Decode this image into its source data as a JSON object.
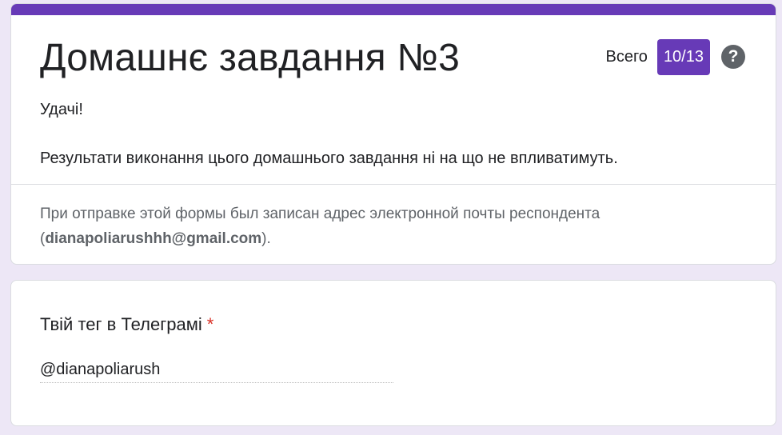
{
  "header": {
    "title": "Домашнє завдання №3",
    "score_label": "Всего",
    "score_value": "10/13",
    "help_icon": "?",
    "description_line1": "Удачі!",
    "description_line2": "Результати виконання цього домашнього завдання ні на що не впливатимуть.",
    "email_note_prefix": "При отправке этой формы был записан адрес электронной почты респондента (",
    "email_address": "dianapoliarushhh@gmail.com",
    "email_note_suffix": ")."
  },
  "question": {
    "title": "Твій тег в Телеграмі",
    "required_marker": "*",
    "answer": "@dianapoliarush"
  },
  "colors": {
    "accent": "#673ab7",
    "background": "#ede7f6",
    "required": "#d93025"
  },
  "icons": {
    "help": "help-circle-icon"
  }
}
